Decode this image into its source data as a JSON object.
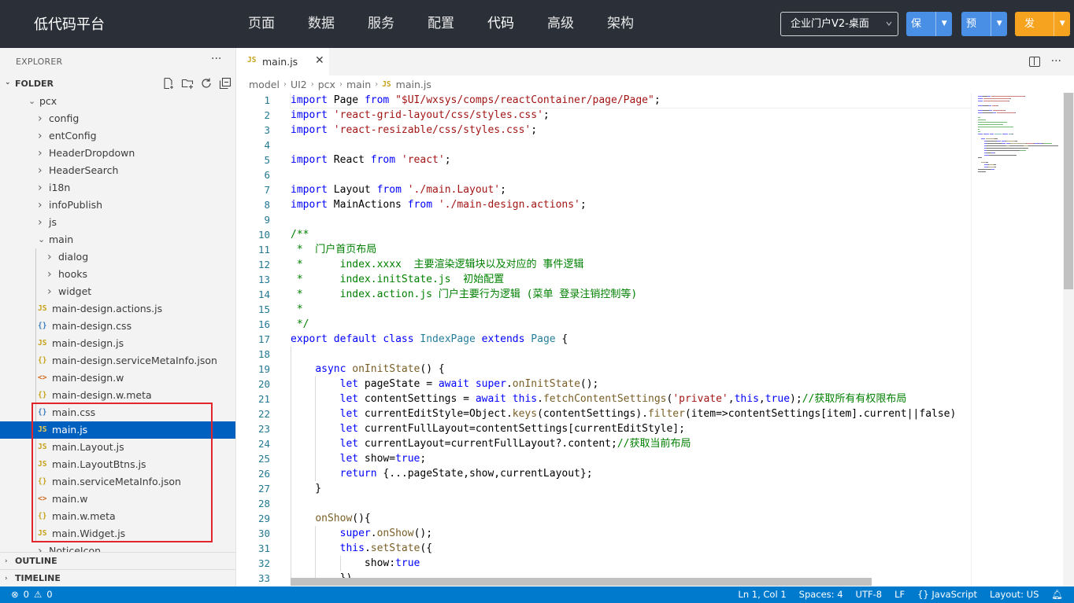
{
  "topbar": {
    "brand": "低代码平台",
    "nav": [
      "页面",
      "数据",
      "服务",
      "配置",
      "代码",
      "高级",
      "架构"
    ],
    "active_nav": "代码",
    "env_select": "企业门户V2-桌面",
    "save_label": "保存",
    "preview_label": "预览",
    "publish_label": "发布",
    "colors": {
      "bar": "#2b3038",
      "save": "#4a8fe6",
      "preview": "#4a8fe6",
      "publish": "#f6a320"
    }
  },
  "sidebar": {
    "title": "EXPLORER",
    "folder_label": "FOLDER",
    "tree": [
      {
        "name": "pcx",
        "kind": "folder",
        "open": true,
        "depth": 0
      },
      {
        "name": "config",
        "kind": "folder",
        "open": false,
        "depth": 1
      },
      {
        "name": "entConfig",
        "kind": "folder",
        "open": false,
        "depth": 1
      },
      {
        "name": "HeaderDropdown",
        "kind": "folder",
        "open": false,
        "depth": 1
      },
      {
        "name": "HeaderSearch",
        "kind": "folder",
        "open": false,
        "depth": 1
      },
      {
        "name": "i18n",
        "kind": "folder",
        "open": false,
        "depth": 1
      },
      {
        "name": "infoPublish",
        "kind": "folder",
        "open": false,
        "depth": 1
      },
      {
        "name": "js",
        "kind": "folder",
        "open": false,
        "depth": 1
      },
      {
        "name": "main",
        "kind": "folder",
        "open": true,
        "depth": 1
      },
      {
        "name": "dialog",
        "kind": "folder",
        "open": false,
        "depth": 2
      },
      {
        "name": "hooks",
        "kind": "folder",
        "open": false,
        "depth": 2
      },
      {
        "name": "widget",
        "kind": "folder",
        "open": false,
        "depth": 2
      },
      {
        "name": "main-design.actions.js",
        "kind": "js",
        "depth": 2
      },
      {
        "name": "main-design.css",
        "kind": "css",
        "depth": 2
      },
      {
        "name": "main-design.js",
        "kind": "js",
        "depth": 2
      },
      {
        "name": "main-design.serviceMetaInfo.json",
        "kind": "json",
        "depth": 2
      },
      {
        "name": "main-design.w",
        "kind": "w",
        "depth": 2
      },
      {
        "name": "main-design.w.meta",
        "kind": "json",
        "depth": 2
      },
      {
        "name": "main.css",
        "kind": "css",
        "depth": 2
      },
      {
        "name": "main.js",
        "kind": "js",
        "depth": 2,
        "selected": true
      },
      {
        "name": "main.Layout.js",
        "kind": "js",
        "depth": 2
      },
      {
        "name": "main.LayoutBtns.js",
        "kind": "js",
        "depth": 2
      },
      {
        "name": "main.serviceMetaInfo.json",
        "kind": "json",
        "depth": 2
      },
      {
        "name": "main.w",
        "kind": "w",
        "depth": 2
      },
      {
        "name": "main.w.meta",
        "kind": "json",
        "depth": 2
      },
      {
        "name": "main.Widget.js",
        "kind": "js",
        "depth": 2
      },
      {
        "name": "NoticeIcon",
        "kind": "folder",
        "open": false,
        "depth": 1
      }
    ],
    "outline_label": "OUTLINE",
    "timeline_label": "TIMELINE"
  },
  "editor": {
    "tab_label": "main.js",
    "breadcrumbs": [
      "model",
      "UI2",
      "pcx",
      "main",
      "main.js"
    ],
    "lines": [
      [
        [
          "kw",
          "import"
        ],
        [
          "p",
          " Page "
        ],
        [
          "kw",
          "from"
        ],
        [
          "p",
          " "
        ],
        [
          "s",
          "\"$UI/wxsys/comps/reactContainer/page/Page\""
        ],
        [
          "p",
          ";"
        ]
      ],
      [
        [
          "kw",
          "import"
        ],
        [
          "p",
          " "
        ],
        [
          "s",
          "'react-grid-layout/css/styles.css'"
        ],
        [
          "p",
          ";"
        ]
      ],
      [
        [
          "kw",
          "import"
        ],
        [
          "p",
          " "
        ],
        [
          "s",
          "'react-resizable/css/styles.css'"
        ],
        [
          "p",
          ";"
        ]
      ],
      [],
      [
        [
          "kw",
          "import"
        ],
        [
          "p",
          " React "
        ],
        [
          "kw",
          "from"
        ],
        [
          "p",
          " "
        ],
        [
          "s",
          "'react'"
        ],
        [
          "p",
          ";"
        ]
      ],
      [],
      [
        [
          "kw",
          "import"
        ],
        [
          "p",
          " Layout "
        ],
        [
          "kw",
          "from"
        ],
        [
          "p",
          " "
        ],
        [
          "s",
          "'./main.Layout'"
        ],
        [
          "p",
          ";"
        ]
      ],
      [
        [
          "kw",
          "import"
        ],
        [
          "p",
          " MainActions "
        ],
        [
          "kw",
          "from"
        ],
        [
          "p",
          " "
        ],
        [
          "s",
          "'./main-design.actions'"
        ],
        [
          "p",
          ";"
        ]
      ],
      [],
      [
        [
          "c",
          "/**"
        ]
      ],
      [
        [
          "c",
          " *  门户首页布局"
        ]
      ],
      [
        [
          "c",
          " *      index.xxxx  主要渲染逻辑块以及对应的 事件逻辑"
        ]
      ],
      [
        [
          "c",
          " *      index.initState.js  初始配置"
        ]
      ],
      [
        [
          "c",
          " *      index.action.js 门户主要行为逻辑 (菜单 登录注销控制等)"
        ]
      ],
      [
        [
          "c",
          " *"
        ]
      ],
      [
        [
          "c",
          " */"
        ]
      ],
      [
        [
          "kw",
          "export"
        ],
        [
          "p",
          " "
        ],
        [
          "kw",
          "default"
        ],
        [
          "p",
          " "
        ],
        [
          "kw",
          "class"
        ],
        [
          "p",
          " "
        ],
        [
          "t",
          "IndexPage"
        ],
        [
          "p",
          " "
        ],
        [
          "kw",
          "extends"
        ],
        [
          "p",
          " "
        ],
        [
          "t",
          "Page"
        ],
        [
          "p",
          " {"
        ]
      ],
      [],
      [
        [
          "p",
          "    "
        ],
        [
          "kw",
          "async"
        ],
        [
          "p",
          " "
        ],
        [
          "f",
          "onInitState"
        ],
        [
          "p",
          "() {"
        ]
      ],
      [
        [
          "p",
          "        "
        ],
        [
          "kw",
          "let"
        ],
        [
          "p",
          " pageState = "
        ],
        [
          "kw",
          "await"
        ],
        [
          "p",
          " "
        ],
        [
          "kw",
          "super"
        ],
        [
          "p",
          "."
        ],
        [
          "f",
          "onInitState"
        ],
        [
          "p",
          "();"
        ]
      ],
      [
        [
          "p",
          "        "
        ],
        [
          "kw",
          "let"
        ],
        [
          "p",
          " contentSettings = "
        ],
        [
          "kw",
          "await"
        ],
        [
          "p",
          " "
        ],
        [
          "kw",
          "this"
        ],
        [
          "p",
          "."
        ],
        [
          "f",
          "fetchContentSettings"
        ],
        [
          "p",
          "("
        ],
        [
          "s",
          "'private'"
        ],
        [
          "p",
          ","
        ],
        [
          "kw",
          "this"
        ],
        [
          "p",
          ","
        ],
        [
          "kw",
          "true"
        ],
        [
          "p",
          ");"
        ],
        [
          "c",
          "//获取所有有权限布局"
        ]
      ],
      [
        [
          "p",
          "        "
        ],
        [
          "kw",
          "let"
        ],
        [
          "p",
          " currentEditStyle=Object."
        ],
        [
          "f",
          "keys"
        ],
        [
          "p",
          "(contentSettings)."
        ],
        [
          "f",
          "filter"
        ],
        [
          "p",
          "(item=>contentSettings[item].current||false)"
        ]
      ],
      [
        [
          "p",
          "        "
        ],
        [
          "kw",
          "let"
        ],
        [
          "p",
          " currentFullLayout=contentSettings[currentEditStyle];"
        ]
      ],
      [
        [
          "p",
          "        "
        ],
        [
          "kw",
          "let"
        ],
        [
          "p",
          " currentLayout=currentFullLayout?.content;"
        ],
        [
          "c",
          "//获取当前布局"
        ]
      ],
      [
        [
          "p",
          "        "
        ],
        [
          "kw",
          "let"
        ],
        [
          "p",
          " show="
        ],
        [
          "kw",
          "true"
        ],
        [
          "p",
          ";"
        ]
      ],
      [
        [
          "p",
          "        "
        ],
        [
          "kw",
          "return"
        ],
        [
          "p",
          " {...pageState,show,currentLayout};"
        ]
      ],
      [
        [
          "p",
          "    }"
        ]
      ],
      [],
      [
        [
          "p",
          "    "
        ],
        [
          "f",
          "onShow"
        ],
        [
          "p",
          "(){"
        ]
      ],
      [
        [
          "p",
          "        "
        ],
        [
          "kw",
          "super"
        ],
        [
          "p",
          "."
        ],
        [
          "f",
          "onShow"
        ],
        [
          "p",
          "();"
        ]
      ],
      [
        [
          "p",
          "        "
        ],
        [
          "kw",
          "this"
        ],
        [
          "p",
          "."
        ],
        [
          "f",
          "setState"
        ],
        [
          "p",
          "({"
        ]
      ],
      [
        [
          "p",
          "            show:"
        ],
        [
          "kw",
          "true"
        ]
      ],
      [
        [
          "p",
          "        })"
        ]
      ]
    ],
    "colors": {
      "keyword": "#0000ff",
      "string": "#a31515",
      "comment": "#008000",
      "type": "#267f99",
      "function": "#795e26",
      "line_number": "#237893"
    }
  },
  "statusbar": {
    "errors": "0",
    "warnings": "0",
    "position": "Ln 1, Col 1",
    "spaces": "Spaces: 4",
    "encoding": "UTF-8",
    "eol": "LF",
    "language": "JavaScript",
    "layout": "Layout: US",
    "color": "#007acc"
  }
}
